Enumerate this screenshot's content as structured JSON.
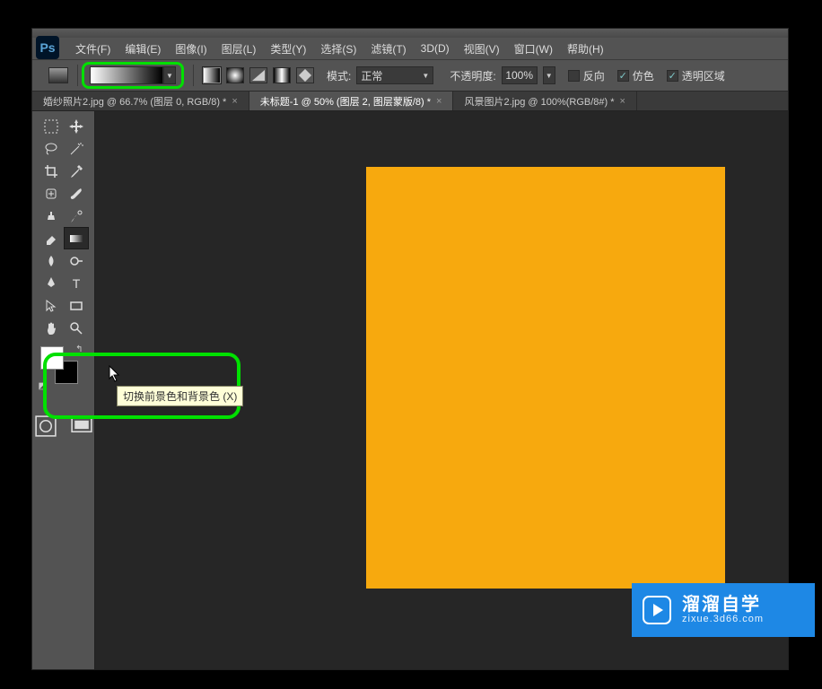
{
  "app": {
    "logo_text": "Ps"
  },
  "menu": {
    "file": "文件(F)",
    "edit": "编辑(E)",
    "image": "图像(I)",
    "layer": "图层(L)",
    "type": "类型(Y)",
    "select": "选择(S)",
    "filter": "滤镜(T)",
    "threeD": "3D(D)",
    "view": "视图(V)",
    "window": "窗口(W)",
    "help": "帮助(H)"
  },
  "options": {
    "mode_label": "模式:",
    "mode_value": "正常",
    "opacity_label": "不透明度:",
    "opacity_value": "100%",
    "reverse": "反向",
    "dither": "仿色",
    "transparency": "透明区域",
    "reverse_checked": false,
    "dither_checked": true,
    "transparency_checked": true
  },
  "tabs": [
    {
      "label": "婚纱照片2.jpg @ 66.7% (图层 0, RGB/8) *",
      "active": false
    },
    {
      "label": "未标题-1 @ 50% (图层 2, 图层蒙版/8) *",
      "active": true
    },
    {
      "label": "风景图片2.jpg @ 100%(RGB/8#) *",
      "active": false
    }
  ],
  "tooltip": {
    "text": "切换前景色和背景色 (X)"
  },
  "colors": {
    "foreground": "#ffffff",
    "background": "#000000",
    "canvas_fill": "#f7a90e"
  },
  "watermark": {
    "brand": "溜溜自学",
    "subtitle": "zixue.3d66.com"
  }
}
